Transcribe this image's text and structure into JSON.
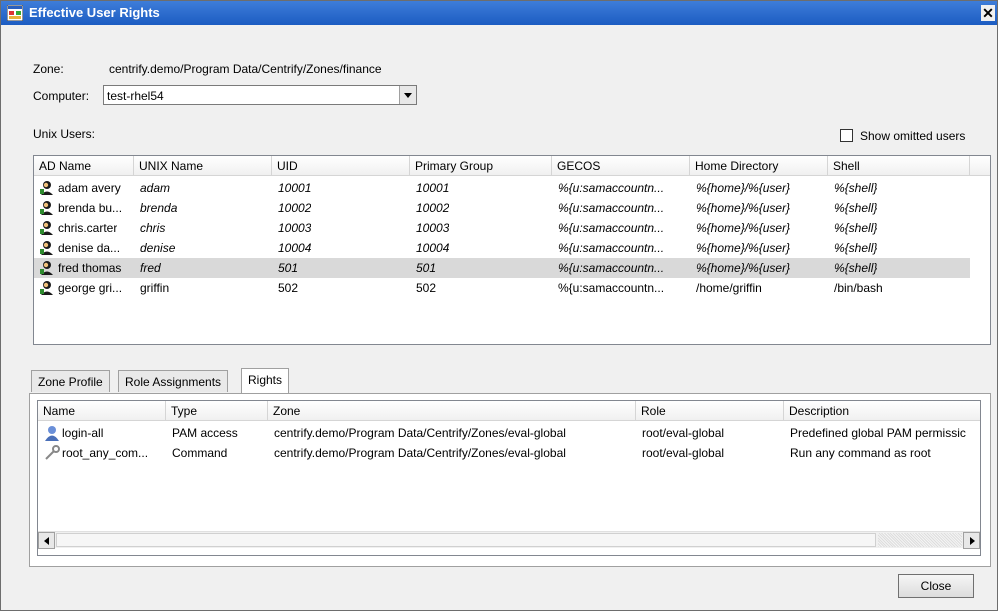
{
  "window": {
    "title": "Effective User Rights",
    "close_glyph": "✕"
  },
  "zone": {
    "label": "Zone:",
    "value": "centrify.demo/Program Data/Centrify/Zones/finance"
  },
  "computer": {
    "label": "Computer:",
    "value": "test-rhel54"
  },
  "unix_users": {
    "label": "Unix Users:",
    "show_omitted_label": "Show omitted users",
    "show_omitted_checked": false,
    "columns": [
      "AD Name",
      "UNIX Name",
      "UID",
      "Primary Group",
      "GECOS",
      "Home Directory",
      "Shell"
    ],
    "rows": [
      {
        "ad_name": "adam avery",
        "unix_name": "adam",
        "uid": "10001",
        "primary_group": "10001",
        "gecos": "%{u:samaccountn...",
        "home": "%{home}/%{user}",
        "shell": "%{shell}",
        "italic": true,
        "selected": false
      },
      {
        "ad_name": "brenda bu...",
        "unix_name": "brenda",
        "uid": "10002",
        "primary_group": "10002",
        "gecos": "%{u:samaccountn...",
        "home": "%{home}/%{user}",
        "shell": "%{shell}",
        "italic": true,
        "selected": false
      },
      {
        "ad_name": "chris.carter",
        "unix_name": "chris",
        "uid": "10003",
        "primary_group": "10003",
        "gecos": "%{u:samaccountn...",
        "home": "%{home}/%{user}",
        "shell": "%{shell}",
        "italic": true,
        "selected": false
      },
      {
        "ad_name": "denise da...",
        "unix_name": "denise",
        "uid": "10004",
        "primary_group": "10004",
        "gecos": "%{u:samaccountn...",
        "home": "%{home}/%{user}",
        "shell": "%{shell}",
        "italic": true,
        "selected": false
      },
      {
        "ad_name": "fred thomas",
        "unix_name": "fred",
        "uid": "501",
        "primary_group": "501",
        "gecos": "%{u:samaccountn...",
        "home": "%{home}/%{user}",
        "shell": "%{shell}",
        "italic": true,
        "selected": true
      },
      {
        "ad_name": "george gri...",
        "unix_name": "griffin",
        "uid": "502",
        "primary_group": "502",
        "gecos": "%{u:samaccountn...",
        "home": "/home/griffin",
        "shell": "/bin/bash",
        "italic": false,
        "selected": false
      }
    ]
  },
  "tabs": [
    {
      "label": "Zone Profile",
      "active": false
    },
    {
      "label": "Role Assignments",
      "active": false
    },
    {
      "label": "Rights",
      "active": true
    }
  ],
  "rights": {
    "columns": [
      "Name",
      "Type",
      "Zone",
      "Role",
      "Description"
    ],
    "rows": [
      {
        "name": "login-all",
        "type": "PAM access",
        "zone": "centrify.demo/Program Data/Centrify/Zones/eval-global",
        "role": "root/eval-global",
        "description": "Predefined global PAM permissic",
        "icon": "pam-icon"
      },
      {
        "name": "root_any_com...",
        "type": "Command",
        "zone": "centrify.demo/Program Data/Centrify/Zones/eval-global",
        "role": "root/eval-global",
        "description": "Run any command as root",
        "icon": "command-icon"
      }
    ]
  },
  "buttons": {
    "close_label": "Close"
  }
}
